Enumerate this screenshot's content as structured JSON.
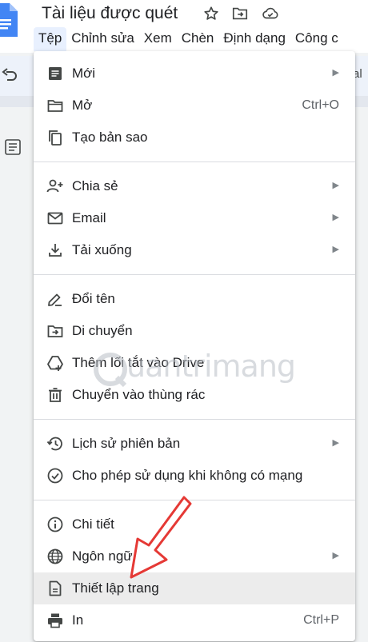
{
  "document": {
    "title": "Tài liệu được quét"
  },
  "menubar": [
    {
      "label": "Tệp"
    },
    {
      "label": "Chỉnh sửa"
    },
    {
      "label": "Xem"
    },
    {
      "label": "Chèn"
    },
    {
      "label": "Định dạng"
    },
    {
      "label": "Công c"
    }
  ],
  "toolbar": {
    "trailing_text": "al"
  },
  "file_menu": {
    "items": [
      {
        "label": "Mới",
        "icon": "new-document-icon",
        "submenu": true,
        "shortcut": ""
      },
      {
        "label": "Mở",
        "icon": "folder-open-icon",
        "submenu": false,
        "shortcut": "Ctrl+O"
      },
      {
        "label": "Tạo bản sao",
        "icon": "copy-icon",
        "submenu": false,
        "shortcut": ""
      },
      {
        "label": "Chia sẻ",
        "icon": "person-add-icon",
        "submenu": true,
        "shortcut": ""
      },
      {
        "label": "Email",
        "icon": "email-icon",
        "submenu": true,
        "shortcut": ""
      },
      {
        "label": "Tải xuống",
        "icon": "download-icon",
        "submenu": true,
        "shortcut": ""
      },
      {
        "label": "Đổi tên",
        "icon": "rename-icon",
        "submenu": false,
        "shortcut": ""
      },
      {
        "label": "Di chuyển",
        "icon": "move-folder-icon",
        "submenu": false,
        "shortcut": ""
      },
      {
        "label": "Thêm lối tắt vào Drive",
        "icon": "drive-shortcut-icon",
        "submenu": false,
        "shortcut": ""
      },
      {
        "label": "Chuyển vào thùng rác",
        "icon": "trash-icon",
        "submenu": false,
        "shortcut": ""
      },
      {
        "label": "Lịch sử phiên bản",
        "icon": "history-icon",
        "submenu": true,
        "shortcut": ""
      },
      {
        "label": "Cho phép sử dụng khi không có mạng",
        "icon": "offline-check-icon",
        "submenu": false,
        "shortcut": ""
      },
      {
        "label": "Chi tiết",
        "icon": "info-icon",
        "submenu": false,
        "shortcut": ""
      },
      {
        "label": "Ngôn ngữ",
        "icon": "globe-icon",
        "submenu": true,
        "shortcut": ""
      },
      {
        "label": "Thiết lập trang",
        "icon": "page-setup-icon",
        "submenu": false,
        "shortcut": ""
      },
      {
        "label": "In",
        "icon": "print-icon",
        "submenu": false,
        "shortcut": "Ctrl+P"
      }
    ]
  },
  "watermark": {
    "text": "uantrimang"
  },
  "colors": {
    "menu_active_bg": "#e8f0fe",
    "hover_bg": "#ececec",
    "icon": "#444746",
    "annotation_arrow": "#e53935",
    "docs_blue": "#4285f4"
  }
}
